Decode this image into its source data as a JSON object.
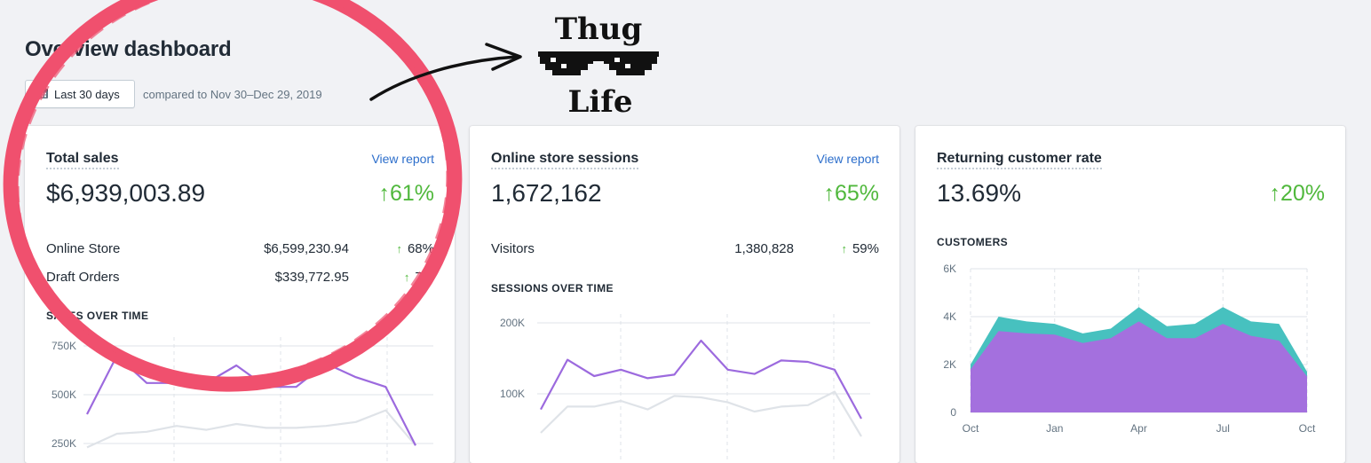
{
  "page": {
    "title": "Overview dashboard",
    "date_button": {
      "icon": "calendar-icon",
      "label": "Last 30 days"
    },
    "compared_text": "compared to Nov 30–Dec 29, 2019"
  },
  "cards": [
    {
      "title": "Total sales",
      "link": "View report",
      "value": "$6,939,003.89",
      "change": "61%",
      "rows": [
        {
          "label": "Online Store",
          "value": "$6,599,230.94",
          "change": "68%"
        },
        {
          "label": "Draft Orders",
          "value": "$339,772.95",
          "change": "7%"
        }
      ],
      "section": "SALES OVER TIME",
      "ticks": [
        "750K",
        "500K",
        "250K"
      ]
    },
    {
      "title": "Online store sessions",
      "link": "View report",
      "value": "1,672,162",
      "change": "65%",
      "rows": [
        {
          "label": "Visitors",
          "value": "1,380,828",
          "change": "59%"
        }
      ],
      "section": "SESSIONS OVER TIME",
      "ticks": [
        "200K",
        "100K"
      ]
    },
    {
      "title": "Returning customer rate",
      "value": "13.69%",
      "change": "20%",
      "section": "CUSTOMERS",
      "ticks": [
        "6K",
        "4K",
        "2K",
        "0"
      ],
      "xticks": [
        "Oct",
        "Jan",
        "Apr",
        "Jul",
        "Oct"
      ]
    }
  ],
  "overlay": {
    "thug_word_1": "Thug",
    "thug_word_2": "Life",
    "circle_color": "#f0506e"
  },
  "chart_data": [
    {
      "type": "line",
      "series": [
        {
          "name": "",
          "color": "#9c6ade",
          "values": [
            400,
            700,
            560,
            560,
            560,
            650,
            540,
            540,
            660,
            590,
            540,
            240
          ]
        },
        {
          "name": "",
          "color": "#dfe3e8",
          "values": [
            230,
            300,
            310,
            340,
            320,
            350,
            330,
            330,
            340,
            360,
            420,
            240
          ]
        }
      ],
      "ylim": [
        250,
        750
      ]
    },
    {
      "type": "line",
      "series": [
        {
          "name": "",
          "color": "#9c6ade",
          "values": [
            78,
            148,
            125,
            134,
            122,
            127,
            175,
            134,
            128,
            147,
            145,
            134,
            65
          ]
        },
        {
          "name": "",
          "color": "#dfe3e8",
          "values": [
            45,
            82,
            82,
            90,
            78,
            97,
            95,
            88,
            75,
            82,
            84,
            103,
            40
          ]
        }
      ],
      "ylim": [
        0,
        200
      ]
    },
    {
      "type": "area",
      "x": [
        "Oct",
        "Jan",
        "Apr",
        "Jul",
        "Oct"
      ],
      "series": [
        {
          "name": "",
          "color": "#47c1bf",
          "values": [
            2000,
            4000,
            3800,
            3700,
            3300,
            3500,
            4400,
            3600,
            3700,
            4400,
            3800,
            3700,
            1700
          ]
        },
        {
          "name": "",
          "color": "#a470de",
          "values": [
            1800,
            3400,
            3300,
            3250,
            2900,
            3100,
            3800,
            3100,
            3100,
            3700,
            3200,
            3000,
            1500
          ]
        }
      ],
      "ylim": [
        0,
        6000
      ]
    }
  ]
}
